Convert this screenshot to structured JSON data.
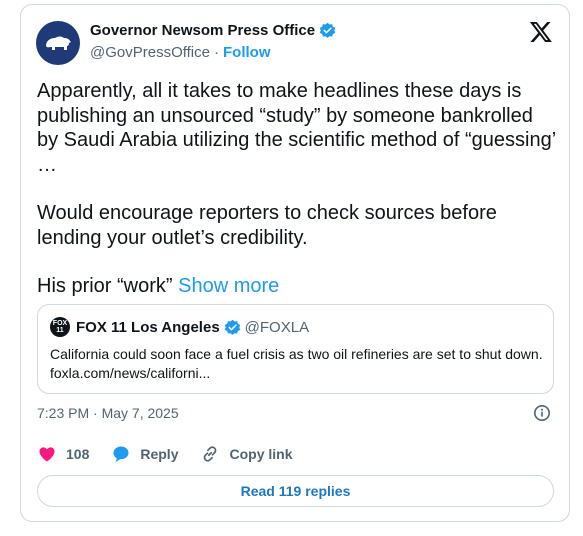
{
  "author": {
    "name": "Governor Newsom Press Office",
    "handle": "@GovPressOffice",
    "separator": "·",
    "follow_label": "Follow",
    "avatar_color": "#1f3a77",
    "verified_color": "#1d9bf0"
  },
  "tweet": {
    "paragraph1": "Apparently, all it takes to make headlines these days is publishing an unsourced “study” by someone bankrolled by Saudi Arabia utilizing the scientific method of “guessing’ …",
    "paragraph2": "Would encourage reporters to check sources before lending your outlet’s credibility.",
    "paragraph3": "His prior “work”",
    "show_more": "Show more"
  },
  "quote": {
    "avatar_line1": "FOX",
    "avatar_line2": "11",
    "name": "FOX 11 Los Angeles",
    "handle": "@FOXLA",
    "text": "California could soon face a fuel crisis as two oil refineries are set to shut down. foxla.com/news/californi..."
  },
  "meta": {
    "timestamp": "7:23 PM · May 7, 2025"
  },
  "actions": {
    "likes": "108",
    "reply_label": "Reply",
    "copy_label": "Copy link",
    "like_color": "#f91880",
    "reply_color": "#1d9bf0"
  },
  "read_replies_label": "Read 119 replies"
}
